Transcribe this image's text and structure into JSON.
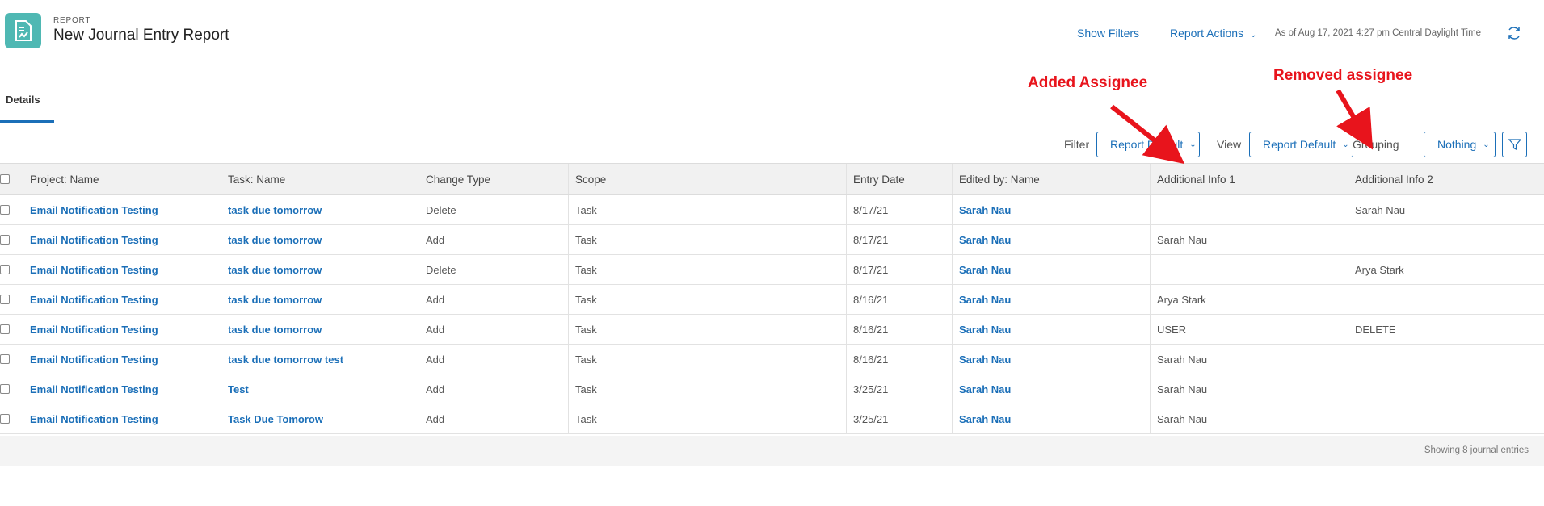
{
  "header": {
    "eyebrow": "REPORT",
    "title": "New Journal Entry Report",
    "show_filters": "Show Filters",
    "report_actions": "Report Actions",
    "as_of": "As of Aug 17, 2021 4:27 pm Central Daylight Time"
  },
  "tabs": [
    {
      "label": "Details"
    }
  ],
  "toolbar": {
    "filter_label": "Filter",
    "filter_value": "Report Default",
    "view_label": "View",
    "view_value": "Report Default",
    "grouping_label": "Grouping",
    "grouping_value": "Nothing"
  },
  "table": {
    "columns": [
      "Project: Name",
      "Task: Name",
      "Change Type",
      "Scope",
      "Entry Date",
      "Edited by: Name",
      "Additional Info 1",
      "Additional Info 2"
    ],
    "rows": [
      [
        "Email Notification Testing",
        "task due tomorrow",
        "Delete",
        "Task",
        "8/17/21",
        "Sarah Nau",
        "",
        "Sarah Nau"
      ],
      [
        "Email Notification Testing",
        "task due tomorrow",
        "Add",
        "Task",
        "8/17/21",
        "Sarah Nau",
        "Sarah Nau",
        ""
      ],
      [
        "Email Notification Testing",
        "task due tomorrow",
        "Delete",
        "Task",
        "8/17/21",
        "Sarah Nau",
        "",
        "Arya Stark"
      ],
      [
        "Email Notification Testing",
        "task due tomorrow",
        "Add",
        "Task",
        "8/16/21",
        "Sarah Nau",
        "Arya Stark",
        ""
      ],
      [
        "Email Notification Testing",
        "task due tomorrow",
        "Add",
        "Task",
        "8/16/21",
        "Sarah Nau",
        "USER",
        "DELETE"
      ],
      [
        "Email Notification Testing",
        "task due tomorrow test",
        "Add",
        "Task",
        "8/16/21",
        "Sarah Nau",
        "Sarah Nau",
        ""
      ],
      [
        "Email Notification Testing",
        "Test",
        "Add",
        "Task",
        "3/25/21",
        "Sarah Nau",
        "Sarah Nau",
        ""
      ],
      [
        "Email Notification Testing",
        "Task Due Tomorow",
        "Add",
        "Task",
        "3/25/21",
        "Sarah Nau",
        "Sarah Nau",
        ""
      ]
    ],
    "footer": "Showing 8 journal entries"
  },
  "annotations": {
    "added": "Added Assignee",
    "removed": "Removed assignee",
    "color": "#e8141c"
  },
  "colors": {
    "accent": "#1b6fb8",
    "app_icon": "#4fb8b3"
  }
}
